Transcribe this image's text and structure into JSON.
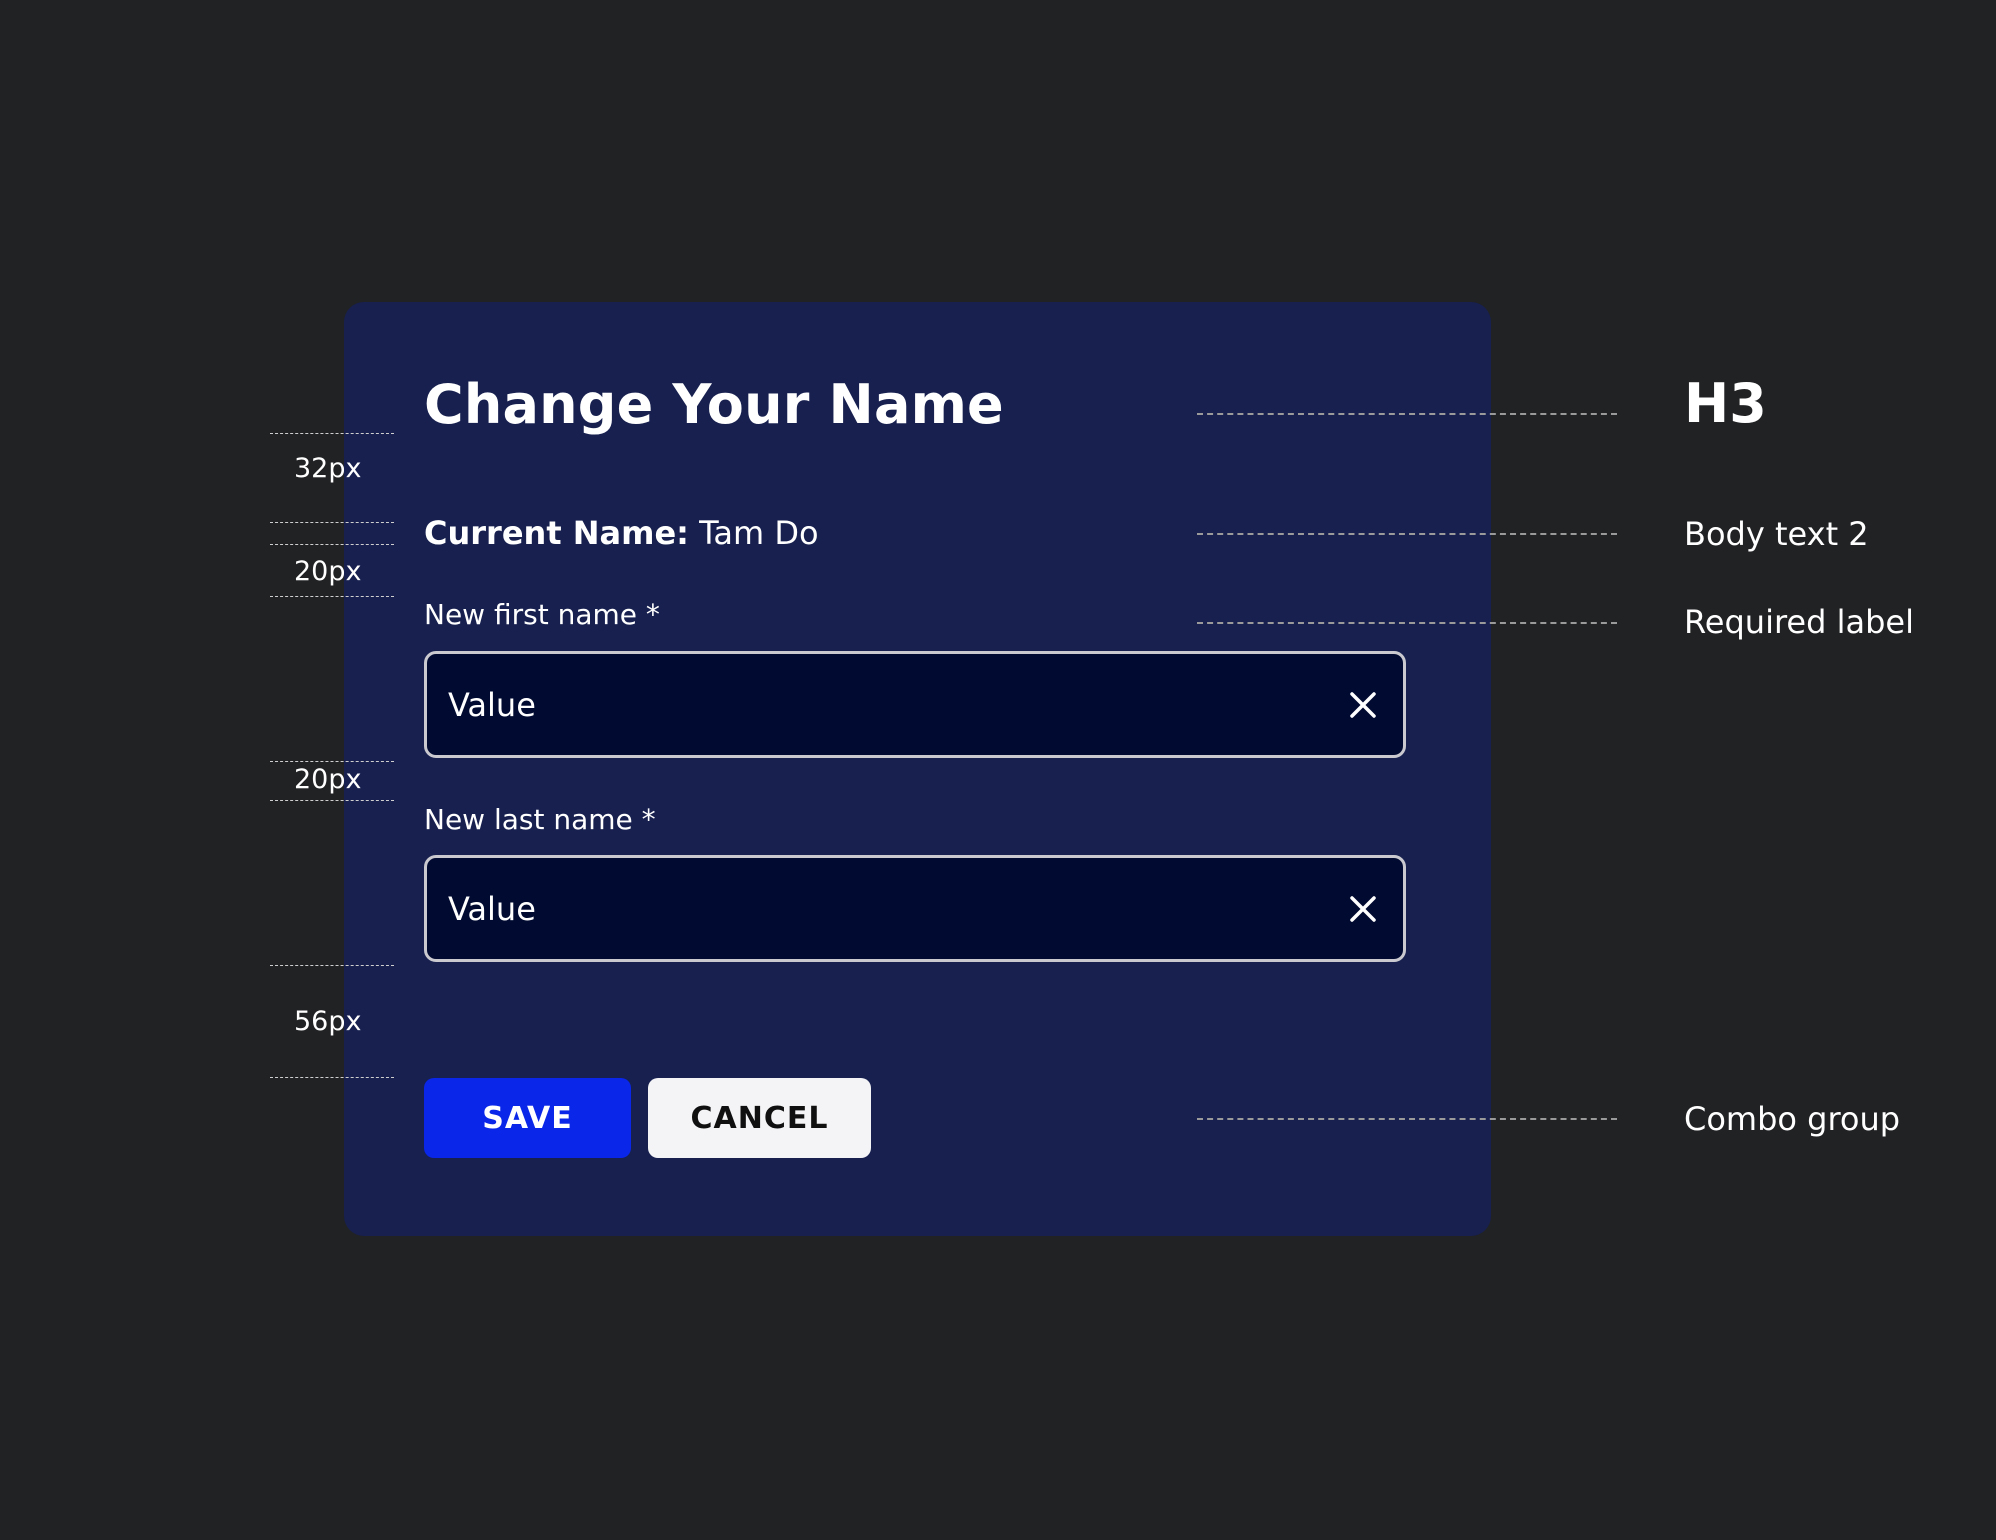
{
  "dialog": {
    "title": "Change Your Name",
    "current_label": "Current Name:",
    "current_value": "Tam Do",
    "first_name": {
      "label": "New first name *",
      "value": "Value"
    },
    "last_name": {
      "label": "New last name *",
      "value": "Value"
    },
    "save_label": "SAVE",
    "cancel_label": "CANCEL"
  },
  "spacing_annotations": [
    "32px",
    "20px",
    "20px",
    "56px"
  ],
  "style_annotations": {
    "heading": "H3",
    "body": "Body text 2",
    "required": "Required label",
    "buttons": "Combo group"
  },
  "colors": {
    "background": "#212224",
    "dialog": "#17204f",
    "input_bg": "#010a30",
    "primary": "#0a26e8",
    "secondary": "#f4f4f6"
  },
  "icons": [
    "close-icon"
  ]
}
